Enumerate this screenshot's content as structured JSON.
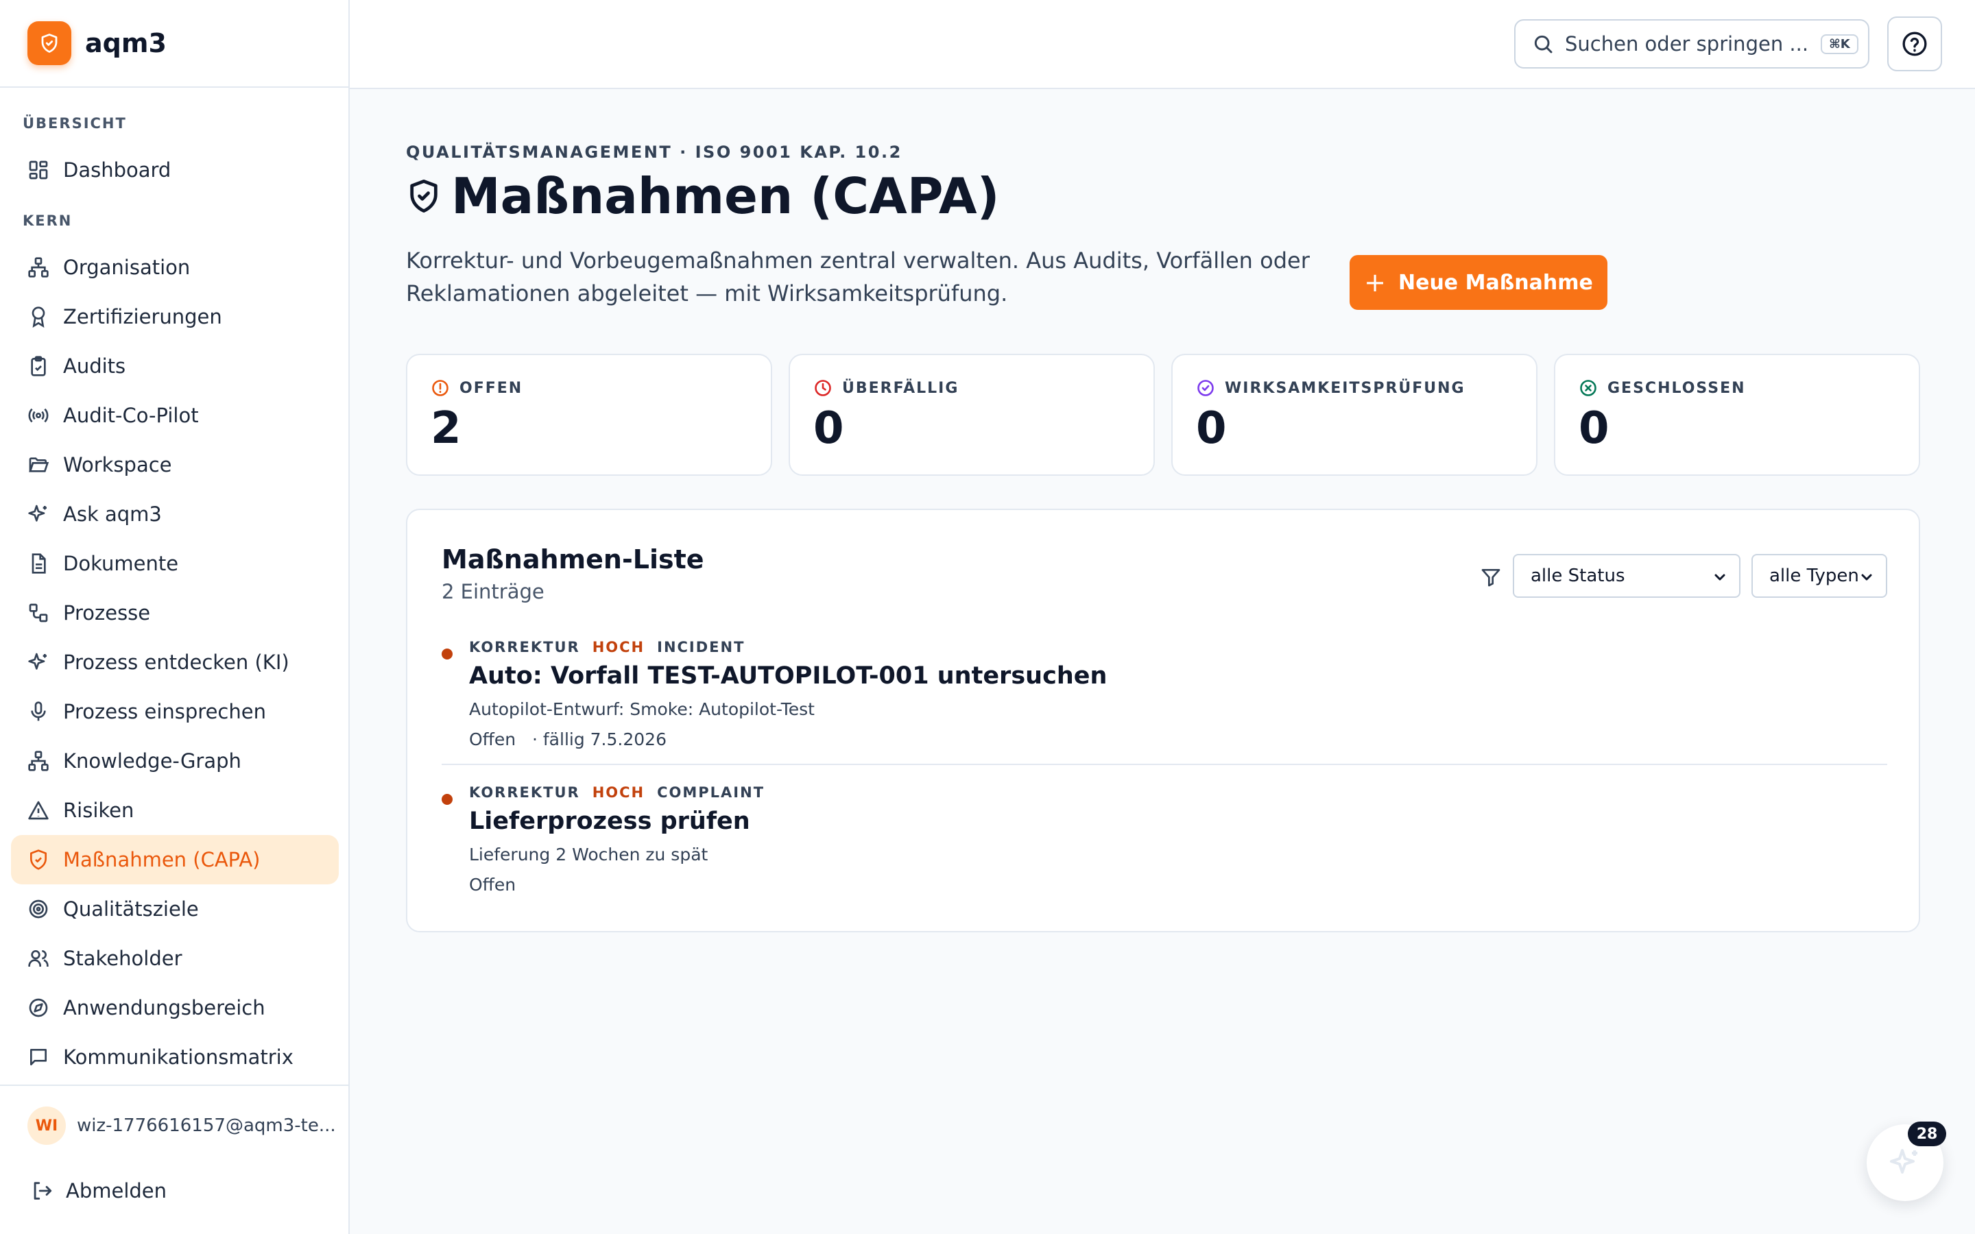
{
  "app": {
    "name": "aqm3"
  },
  "sidebar": {
    "section_overview": "ÜBERSICHT",
    "section_core": "KERN",
    "items": [
      {
        "label": "Dashboard",
        "icon": "dashboard-icon"
      },
      {
        "label": "Organisation",
        "icon": "org-chart-icon"
      },
      {
        "label": "Zertifizierungen",
        "icon": "award-icon"
      },
      {
        "label": "Audits",
        "icon": "clipboard-check-icon"
      },
      {
        "label": "Audit-Co-Pilot",
        "icon": "radio-broadcast-icon"
      },
      {
        "label": "Workspace",
        "icon": "folder-open-icon"
      },
      {
        "label": "Ask aqm3",
        "icon": "sparkles-icon"
      },
      {
        "label": "Dokumente",
        "icon": "file-text-icon"
      },
      {
        "label": "Prozesse",
        "icon": "workflow-icon"
      },
      {
        "label": "Prozess entdecken (KI)",
        "icon": "sparkles-icon"
      },
      {
        "label": "Prozess einsprechen",
        "icon": "microphone-icon"
      },
      {
        "label": "Knowledge-Graph",
        "icon": "network-icon"
      },
      {
        "label": "Risiken",
        "icon": "warning-triangle-icon"
      },
      {
        "label": "Maßnahmen (CAPA)",
        "icon": "shield-check-icon",
        "active": true
      },
      {
        "label": "Qualitätsziele",
        "icon": "target-icon"
      },
      {
        "label": "Stakeholder",
        "icon": "users-icon"
      },
      {
        "label": "Anwendungsbereich",
        "icon": "compass-icon"
      },
      {
        "label": "Kommunikationsmatrix",
        "icon": "message-square-icon"
      }
    ],
    "user": {
      "initials": "WI",
      "email": "wiz-1776616157@aqm3-te..."
    },
    "logout_label": "Abmelden"
  },
  "topbar": {
    "search_placeholder": "Suchen oder springen ...",
    "search_shortcut": "⌘K"
  },
  "page": {
    "eyebrow": "QUALITÄTSMANAGEMENT · ISO 9001 KAP. 10.2",
    "title": "Maßnahmen (CAPA)",
    "description": "Korrektur- und Vorbeugemaßnahmen zentral verwalten. Aus Audits, Vorfällen oder Reklamationen abgeleitet — mit Wirksamkeitsprüfung.",
    "new_button_label": "Neue Maßnahme"
  },
  "stats": [
    {
      "label": "OFFEN",
      "value": "2",
      "icon": "alert-circle-icon",
      "color": "#ea580c"
    },
    {
      "label": "ÜBERFÄLLIG",
      "value": "0",
      "icon": "clock-icon",
      "color": "#dc2626"
    },
    {
      "label": "WIRKSAMKEITSPRÜFUNG",
      "value": "0",
      "icon": "check-circle-icon",
      "color": "#7c3aed"
    },
    {
      "label": "GESCHLOSSEN",
      "value": "0",
      "icon": "x-circle-icon",
      "color": "#047857"
    }
  ],
  "list": {
    "title": "Maßnahmen-Liste",
    "count_label": "2 Einträge",
    "filter_status": "alle Status",
    "filter_type": "alle Typen",
    "items": [
      {
        "tag_type": "KORREKTUR",
        "tag_priority": "HOCH",
        "tag_source": "INCIDENT",
        "title": "Auto: Vorfall TEST-AUTOPILOT-001 untersuchen",
        "subtitle": "Autopilot-Entwurf: Smoke: Autopilot-Test",
        "status": "Offen",
        "due": "· fällig 7.5.2026"
      },
      {
        "tag_type": "KORREKTUR",
        "tag_priority": "HOCH",
        "tag_source": "COMPLAINT",
        "title": "Lieferprozess prüfen",
        "subtitle": "Lieferung 2 Wochen zu spät",
        "status": "Offen",
        "due": ""
      }
    ]
  },
  "assistant": {
    "badge_count": "28",
    "icon": "sparkles-icon"
  },
  "colors": {
    "accent": "#f97316",
    "accent_text": "#ea580c",
    "active_bg": "#ffedd5",
    "priority": "#c2410c"
  }
}
